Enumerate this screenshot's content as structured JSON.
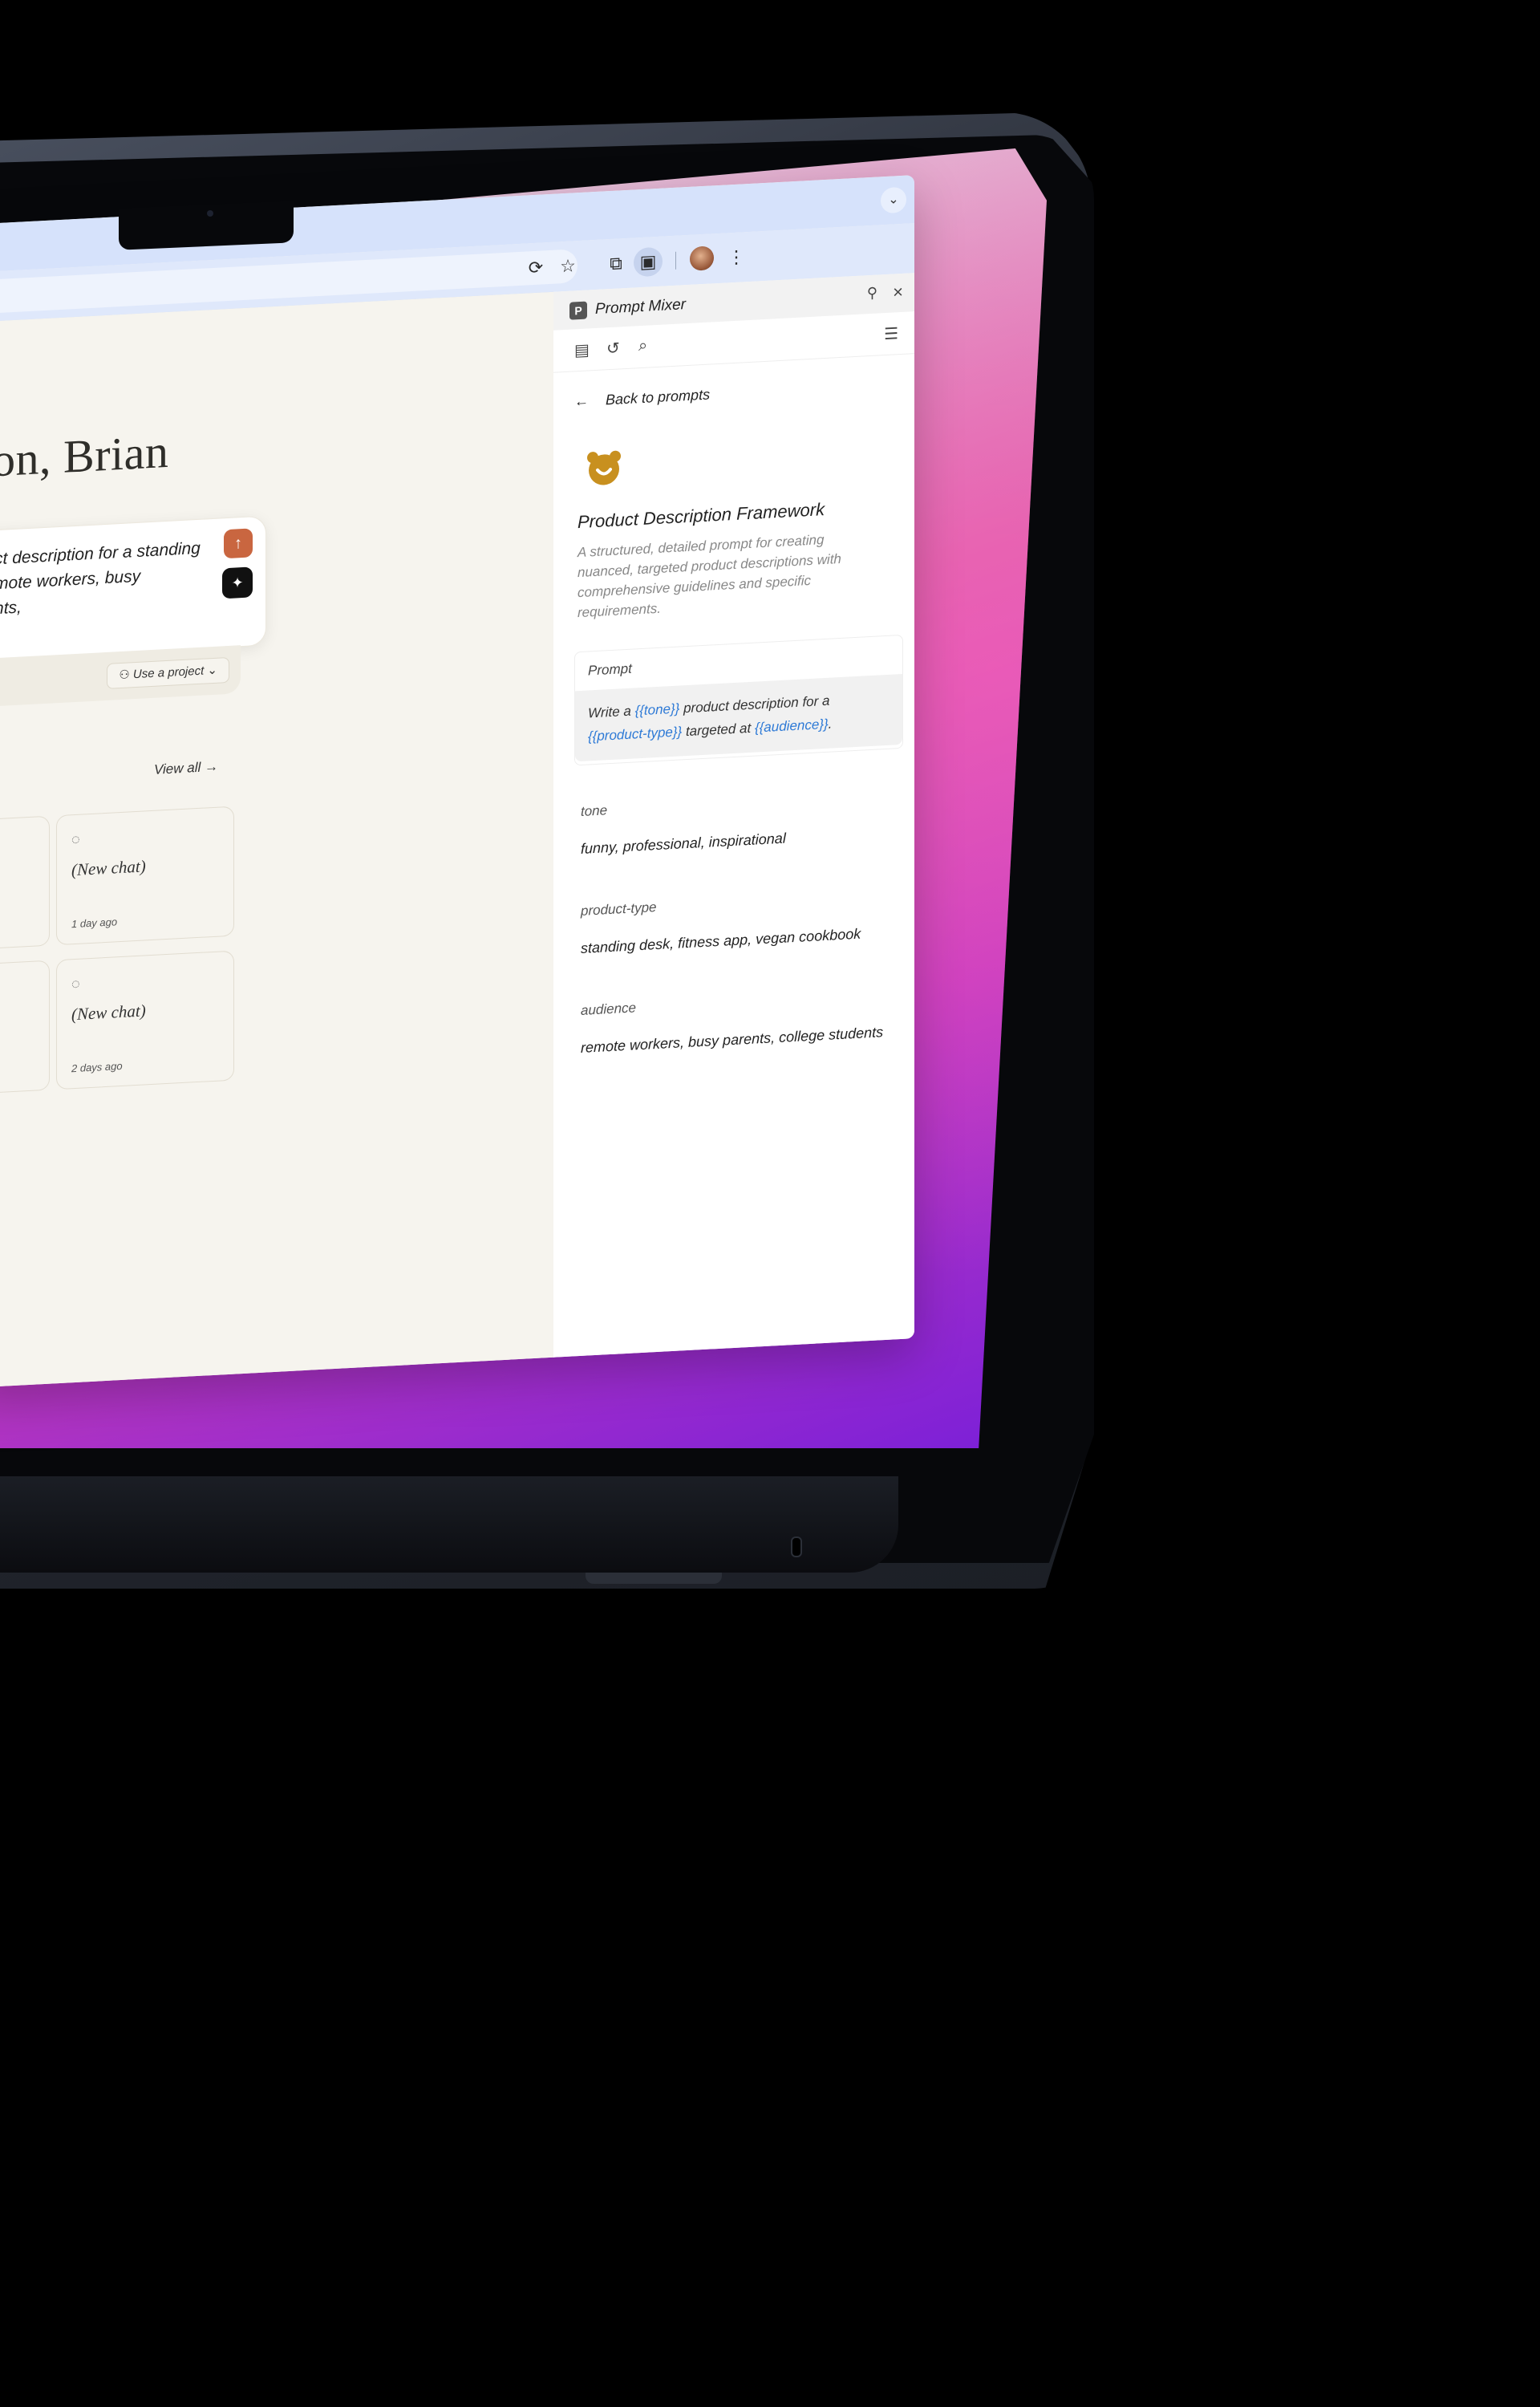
{
  "browser": {
    "tab_menu_icon": "chevron-down-icon",
    "toolbar_icons": [
      "share-screen-icon",
      "star-icon",
      "extensions-icon",
      "side-panel-icon",
      "profile-avatar",
      "more-vertical-icon"
    ]
  },
  "page": {
    "greeting": "ernoon, Brian",
    "composer": {
      "text": "roduct description for a standing\n at remote workers, busy parents,",
      "use_project_label": "Use a project"
    },
    "view_all_label": "View all →",
    "recent_chats": [
      {
        "title": "(New chat)",
        "time": "1 day ago"
      },
      {
        "title": "(New chat)",
        "time": "2 days ago"
      }
    ]
  },
  "panel": {
    "name": "Prompt Mixer",
    "logo_letter": "P",
    "back_label": "Back to prompts",
    "prompt_title": "Product Description Framework",
    "prompt_description": "A structured, detailed prompt for creating nuanced, targeted product descriptions with comprehensive guidelines and specific requirements.",
    "prompt_section_label": "Prompt",
    "prompt_parts": {
      "p1": "Write a ",
      "v1": "{{tone}}",
      "p2": " product description for a ",
      "v2": "{{product-type}}",
      "p3": " targeted at ",
      "v3": "{{audience}}",
      "p4": "."
    },
    "variables": [
      {
        "name": "tone",
        "value": "funny, professional, inspirational"
      },
      {
        "name": "product-type",
        "value": "standing desk, fitness app, vegan cookbook"
      },
      {
        "name": "audience",
        "value": "remote workers, busy parents, college students"
      }
    ]
  },
  "colors": {
    "send_button": "#c96640",
    "variable_highlight": "#2e7ad6",
    "tabbar": "#d6e2fb"
  }
}
